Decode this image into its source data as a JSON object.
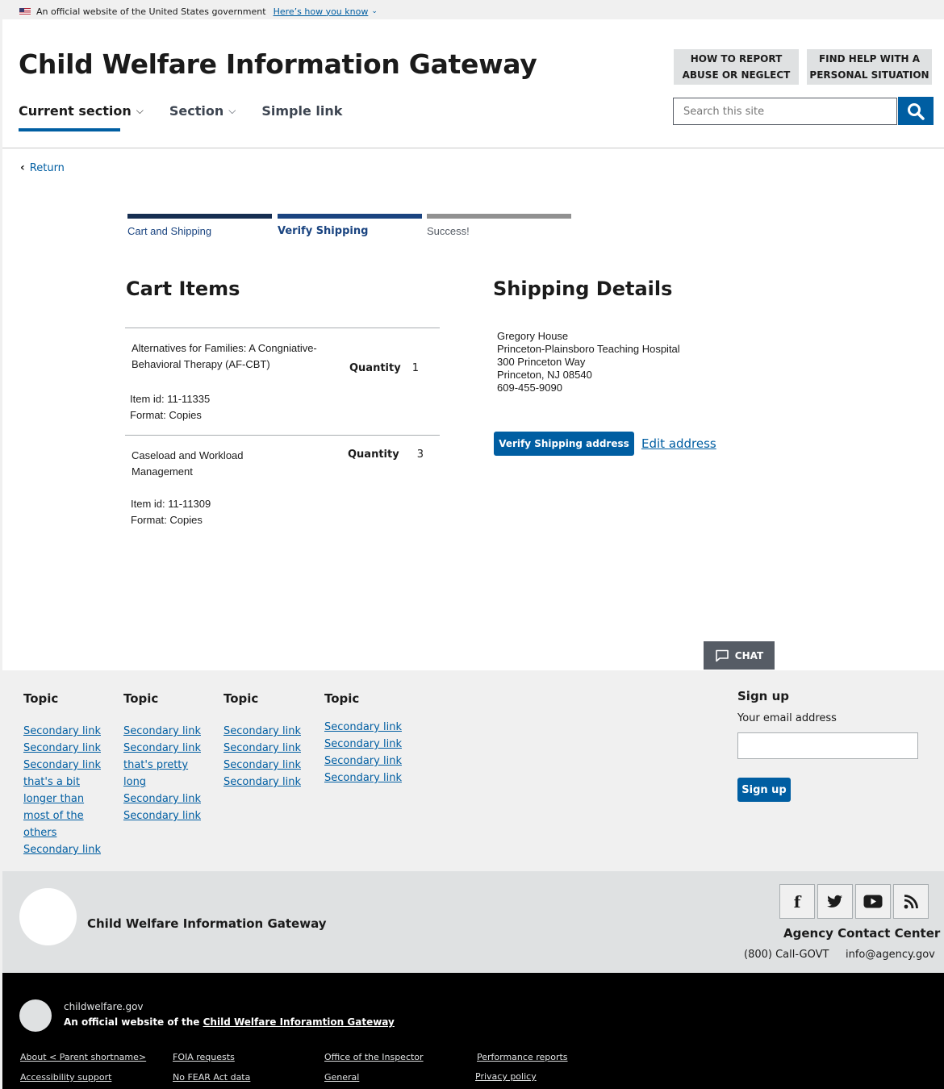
{
  "banner": {
    "text": "An official website of the United States government",
    "link": "Here’s how you know"
  },
  "header": {
    "title": "Child Welfare Information Gateway",
    "nav": [
      {
        "label": "Current section"
      },
      {
        "label": "Section"
      },
      {
        "label": "Simple link"
      }
    ],
    "util_report": "HOW TO REPORT\nABUSE OR NEGLECT",
    "util_help": "FIND HELP WITH A\nPERSONAL SITUATION",
    "search_placeholder": "Search this site"
  },
  "return_label": "Return",
  "steps": [
    {
      "label": "Cart and Shipping",
      "status": "complete",
      "color": "#162e51"
    },
    {
      "label": "Verify Shipping",
      "status": "current",
      "color": "#1a4480"
    },
    {
      "label": "Success!",
      "status": "upcoming",
      "color": "#919191"
    }
  ],
  "cart": {
    "heading": "Cart Items",
    "quantity_label": "Quantity",
    "items": [
      {
        "title": "Alternatives for Families: A Congniative-Behavioral Therapy (AF-CBT)",
        "quantity": "1",
        "item_id": "Item id: 11-11335",
        "format": "Format: Copies"
      },
      {
        "title": "Caseload and Workload Management",
        "quantity": "3",
        "item_id": "Item id: 11-11309",
        "format": "Format: Copies"
      }
    ]
  },
  "shipping": {
    "heading": "Shipping Details",
    "address": [
      "Gregory House",
      "Princeton-Plainsboro Teaching Hospital",
      "300 Princeton Way",
      "Princeton, NJ 08540",
      "609-455-9090"
    ],
    "verify_button": "Verify Shipping address",
    "edit_link": "Edit address"
  },
  "chat_label": "CHAT",
  "footer": {
    "topics": [
      {
        "title": "Topic",
        "links": [
          "Secondary link",
          "Secondary link",
          "Secondary link that's a bit longer than most of the others",
          "Secondary link"
        ]
      },
      {
        "title": "Topic",
        "links": [
          "Secondary link",
          "Secondary link that's pretty long",
          "Secondary link",
          "Secondary link"
        ]
      },
      {
        "title": "Topic",
        "links": [
          "Secondary link",
          "Secondary link",
          "Secondary link",
          "Secondary link"
        ]
      },
      {
        "title": "Topic",
        "links": [
          "Secondary link",
          "Secondary link",
          "Secondary link",
          "Secondary link"
        ]
      }
    ],
    "signup": {
      "title": "Sign up",
      "label": "Your email address",
      "button": "Sign up"
    },
    "site_name": "Child Welfare Information Gateway",
    "social": [
      "facebook-icon",
      "twitter-icon",
      "youtube-icon",
      "rss-icon"
    ],
    "contact_title": "Agency Contact Center",
    "phone": "(800) Call-GOVT",
    "email": "info@agency.gov",
    "domain": "childwelfare.gov",
    "official_prefix": "An official website of the",
    "official_link": "Child Welfare Inforamtion Gateway",
    "links": [
      "About < Parent shortname>",
      "Accessibility support",
      "FOIA requests",
      "No FEAR Act data",
      "Office of the Inspector",
      "General",
      "Performance reports",
      "Privacy policy"
    ]
  }
}
